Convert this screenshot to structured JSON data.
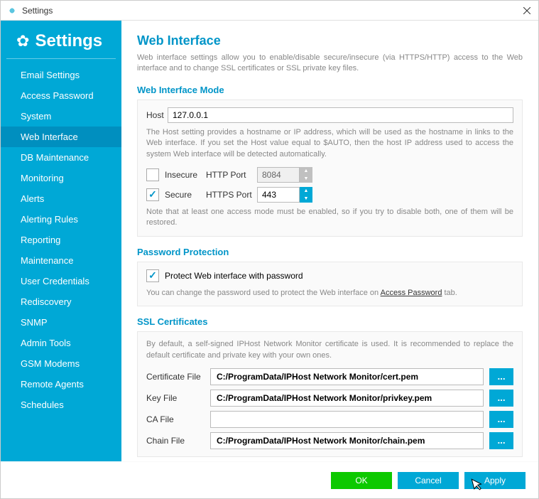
{
  "window": {
    "title": "Settings"
  },
  "sidebar": {
    "header": "Settings",
    "items": [
      {
        "label": "Email Settings"
      },
      {
        "label": "Access Password"
      },
      {
        "label": "System"
      },
      {
        "label": "Web Interface"
      },
      {
        "label": "DB Maintenance"
      },
      {
        "label": "Monitoring"
      },
      {
        "label": "Alerts"
      },
      {
        "label": "Alerting Rules"
      },
      {
        "label": "Reporting"
      },
      {
        "label": "Maintenance"
      },
      {
        "label": "User Credentials"
      },
      {
        "label": "Rediscovery"
      },
      {
        "label": "SNMP"
      },
      {
        "label": "Admin Tools"
      },
      {
        "label": "GSM Modems"
      },
      {
        "label": "Remote Agents"
      },
      {
        "label": "Schedules"
      }
    ],
    "active_index": 3
  },
  "main": {
    "title": "Web Interface",
    "description": "Web interface settings allow you to enable/disable secure/insecure (via HTTPS/HTTP) access to the Web interface and to change SSL certificates or SSL private key files.",
    "mode": {
      "title": "Web Interface Mode",
      "host_label": "Host",
      "host_value": "127.0.0.1",
      "host_help": "The Host setting provides a hostname or IP address, which will be used as the hostname in links to the Web interface. If you set the Host value equal to $AUTO, then the host IP address used to access the system Web interface will be detected automatically.",
      "insecure_label": "Insecure",
      "insecure_checked": false,
      "http_port_label": "HTTP Port",
      "http_port_value": "8084",
      "secure_label": "Secure",
      "secure_checked": true,
      "https_port_label": "HTTPS Port",
      "https_port_value": "443",
      "note": "Note that at least one access mode must be enabled, so if you try to disable both, one of them will be restored."
    },
    "password": {
      "title": "Password Protection",
      "protect_checked": true,
      "protect_label": "Protect Web interface with password",
      "help_prefix": "You can change the password used to protect the Web interface on ",
      "link_text": "Access Password",
      "help_suffix": " tab."
    },
    "ssl": {
      "title": "SSL Certificates",
      "help": "By default, a self-signed IPHost Network Monitor certificate is used. It is recommended to replace the default certificate and private key with your own ones.",
      "cert_label": "Certificate File",
      "cert_value": "C:/ProgramData/IPHost Network Monitor/cert.pem",
      "key_label": "Key File",
      "key_value": "C:/ProgramData/IPHost Network Monitor/privkey.pem",
      "ca_label": "CA File",
      "ca_value": "",
      "chain_label": "Chain File",
      "chain_value": "C:/ProgramData/IPHost Network Monitor/chain.pem",
      "browse_label": "..."
    }
  },
  "footer": {
    "ok": "OK",
    "cancel": "Cancel",
    "apply": "Apply"
  }
}
